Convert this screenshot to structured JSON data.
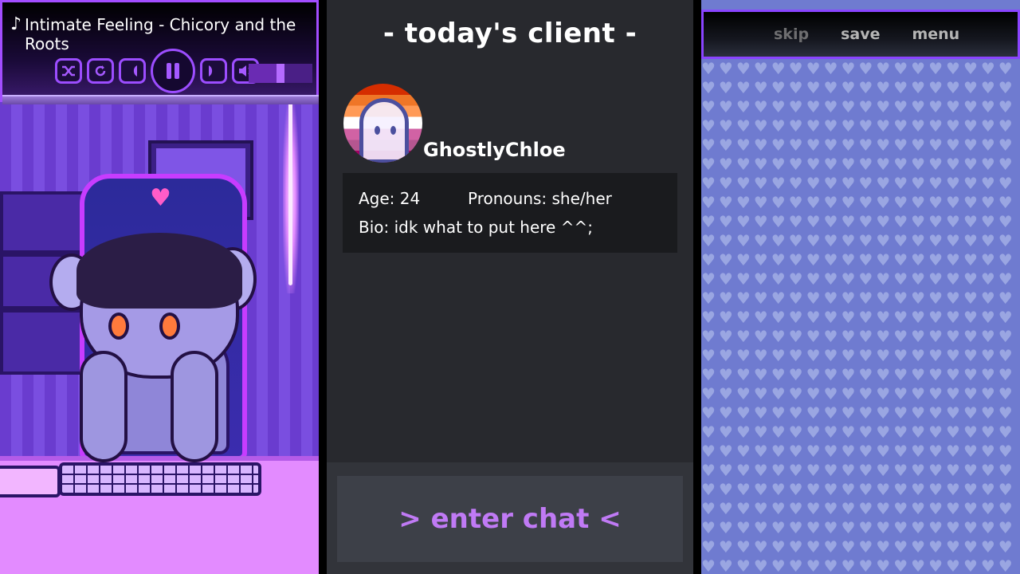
{
  "music_player": {
    "track_title": "Intimate Feeling - Chicory and the Roots",
    "note_glyph": "♪",
    "volume_level": 0.5,
    "icons": [
      "shuffle-icon",
      "repeat-icon",
      "previous-icon",
      "pause-icon",
      "next-icon",
      "volume-icon"
    ]
  },
  "client_page": {
    "title": "- today's client -",
    "username": "GhostlyChloe",
    "age": "Age: 24",
    "pronouns": "Pronouns: she/her",
    "bio": "Bio: idk what to put here ^^;",
    "enter_chat_label": "> enter chat <"
  },
  "menu": {
    "skip_label": "skip",
    "save_label": "save",
    "menu_label": "menu"
  },
  "colors": {
    "accent_purple": "#a24dff",
    "enter_chat_text": "#c07af5",
    "center_bg": "#28292e",
    "pattern_bg": "#6f7bd0"
  }
}
